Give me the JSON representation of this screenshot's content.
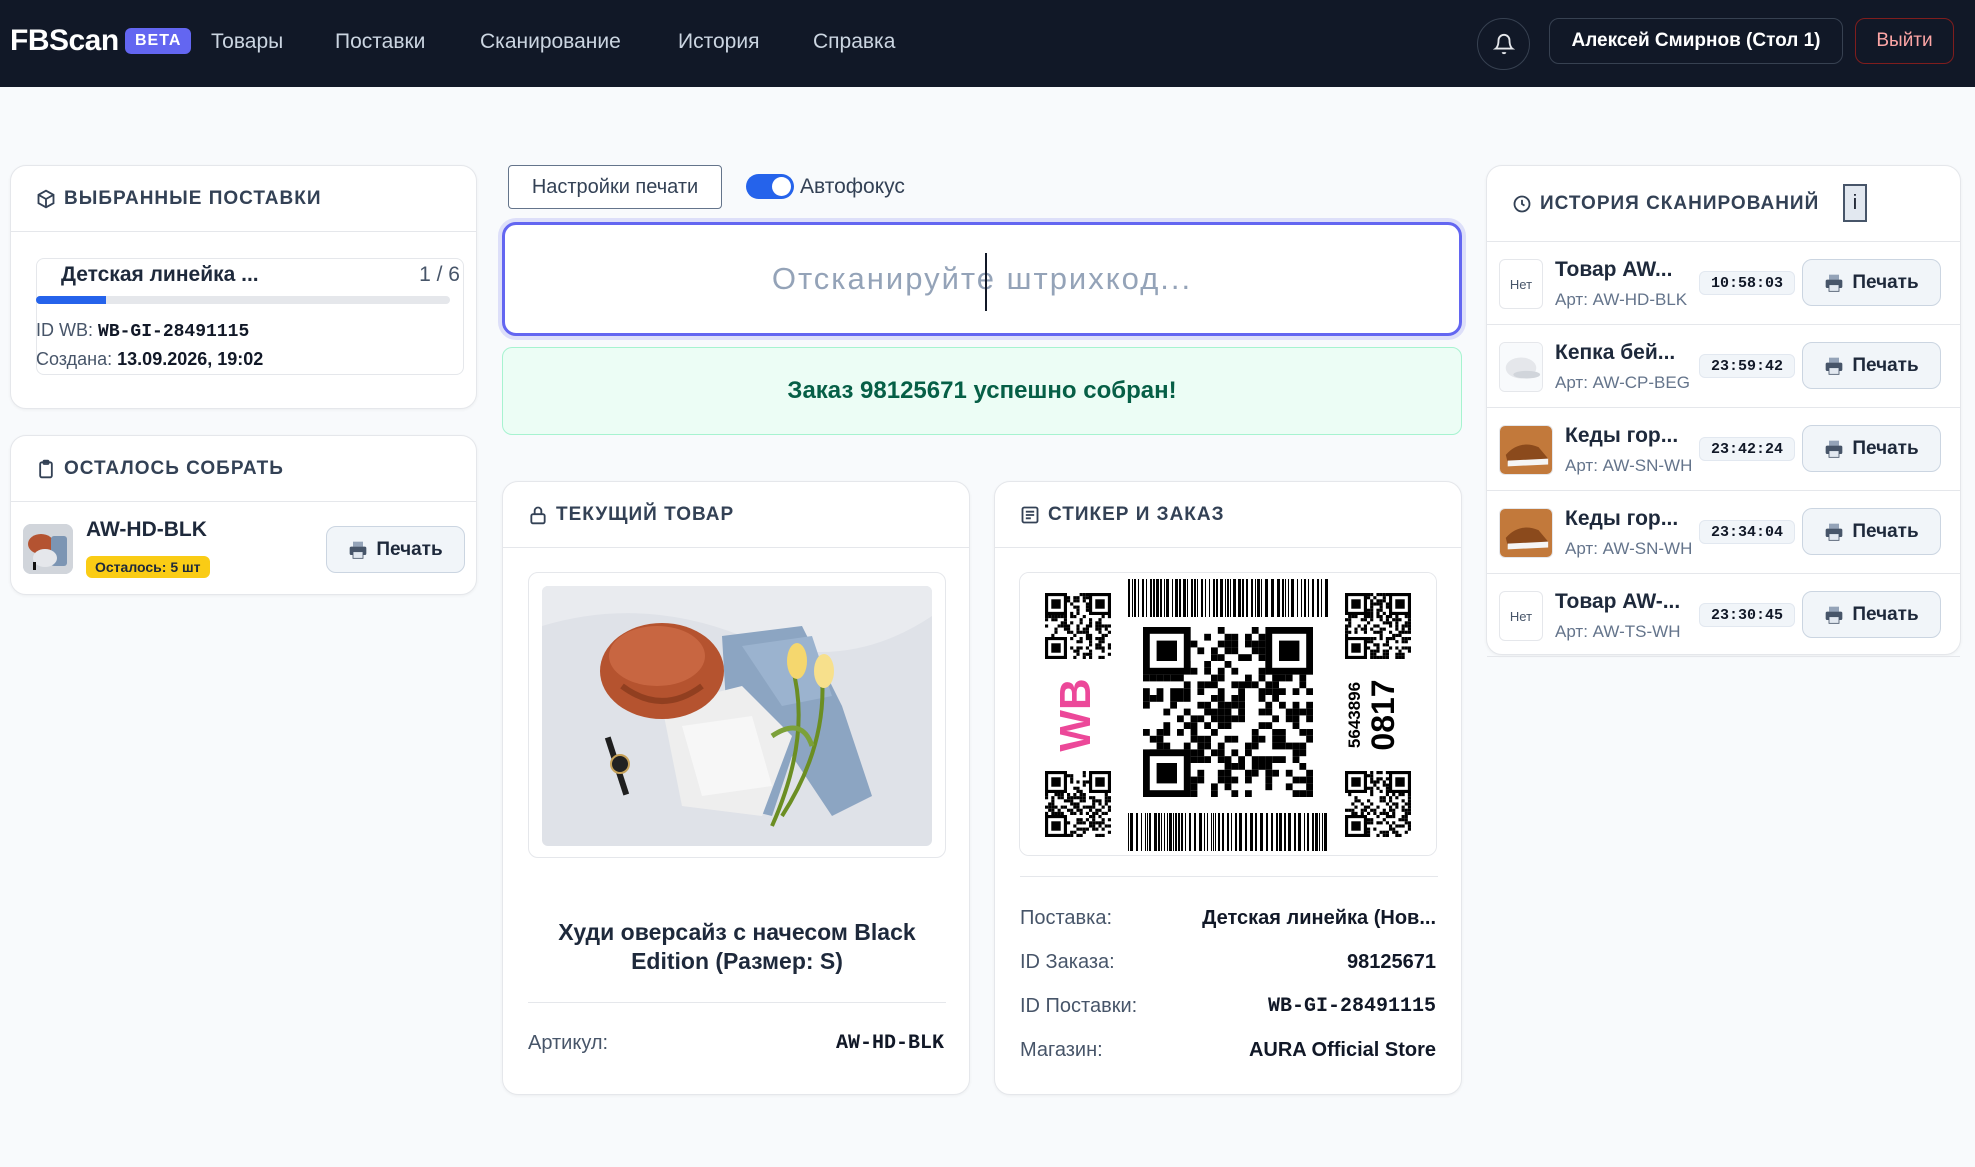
{
  "nav": {
    "brand": "FBScan",
    "beta": "BETA",
    "links": [
      "Товары",
      "Поставки",
      "Сканирование",
      "История",
      "Справка"
    ],
    "user": "Алексей Смирнов (Стол 1)",
    "logout": "Выйти"
  },
  "selected_supplies": {
    "title": "ВЫБРАННЫЕ ПОСТАВКИ",
    "name": "Детская линейка ...",
    "count": "1 / 6",
    "progress_fraction": 0.17,
    "id_label": "ID WB:",
    "id_value": "WB-GI-28491115",
    "created_label": "Создана:",
    "created_value": "13.09.2026, 19:02"
  },
  "remaining": {
    "title": "ОСТАЛОСЬ СОБРАТЬ",
    "sku": "AW-HD-BLK",
    "badge": "Осталось: 5 шт",
    "print_label": "Печать"
  },
  "toolbar": {
    "settings_label": "Настройки печати",
    "autofocus_label": "Автофокус",
    "autofocus_on": true
  },
  "scan": {
    "placeholder": "Отсканируйте штрихкод...",
    "success_message": "Заказ 98125671 успешно собран!"
  },
  "current_item": {
    "title": "ТЕКУЩИЙ ТОВАР",
    "product_name": "Худи оверсайз с начесом Black Edition (Размер: S)",
    "article_label": "Артикул:",
    "article_value": "AW-HD-BLK"
  },
  "sticker": {
    "title": "СТИКЕР И ЗАКАЗ",
    "logo": "WB",
    "code_small": "5643896",
    "code_big": "0817",
    "rows": [
      {
        "label": "Поставка:",
        "value": "Детская линейка (Нов..."
      },
      {
        "label": "ID Заказа:",
        "value": "98125671"
      },
      {
        "label": "ID Поставки:",
        "value": "WB-GI-28491115"
      },
      {
        "label": "Магазин:",
        "value": "AURA Official Store"
      }
    ]
  },
  "history": {
    "title": "ИСТОРИЯ СКАНИРОВАНИЙ",
    "info": "i",
    "print_label": "Печать",
    "items": [
      {
        "thumb": "Нет",
        "name": "Товар AW...",
        "art": "Арт: AW-HD-BLK",
        "time": "10:58:03"
      },
      {
        "thumb": "cap",
        "name": "Кепка бей...",
        "art": "Арт: AW-CP-BEG",
        "time": "23:59:42"
      },
      {
        "thumb": "shoe",
        "name": "Кеды гор...",
        "art": "Арт: AW-SN-WH",
        "time": "23:42:24"
      },
      {
        "thumb": "shoe",
        "name": "Кеды гор...",
        "art": "Арт: AW-SN-WH",
        "time": "23:34:04"
      },
      {
        "thumb": "Нет",
        "name": "Товар AW-...",
        "art": "Арт: AW-TS-WH",
        "time": "23:30:45"
      }
    ]
  },
  "colors": {
    "nav_bg": "#111827",
    "accent": "#6366f1",
    "primary": "#2563eb",
    "success_bg": "#ecfdf5",
    "success_text": "#065f46",
    "badge": "#facc15",
    "wb_pink": "#ec4899"
  }
}
